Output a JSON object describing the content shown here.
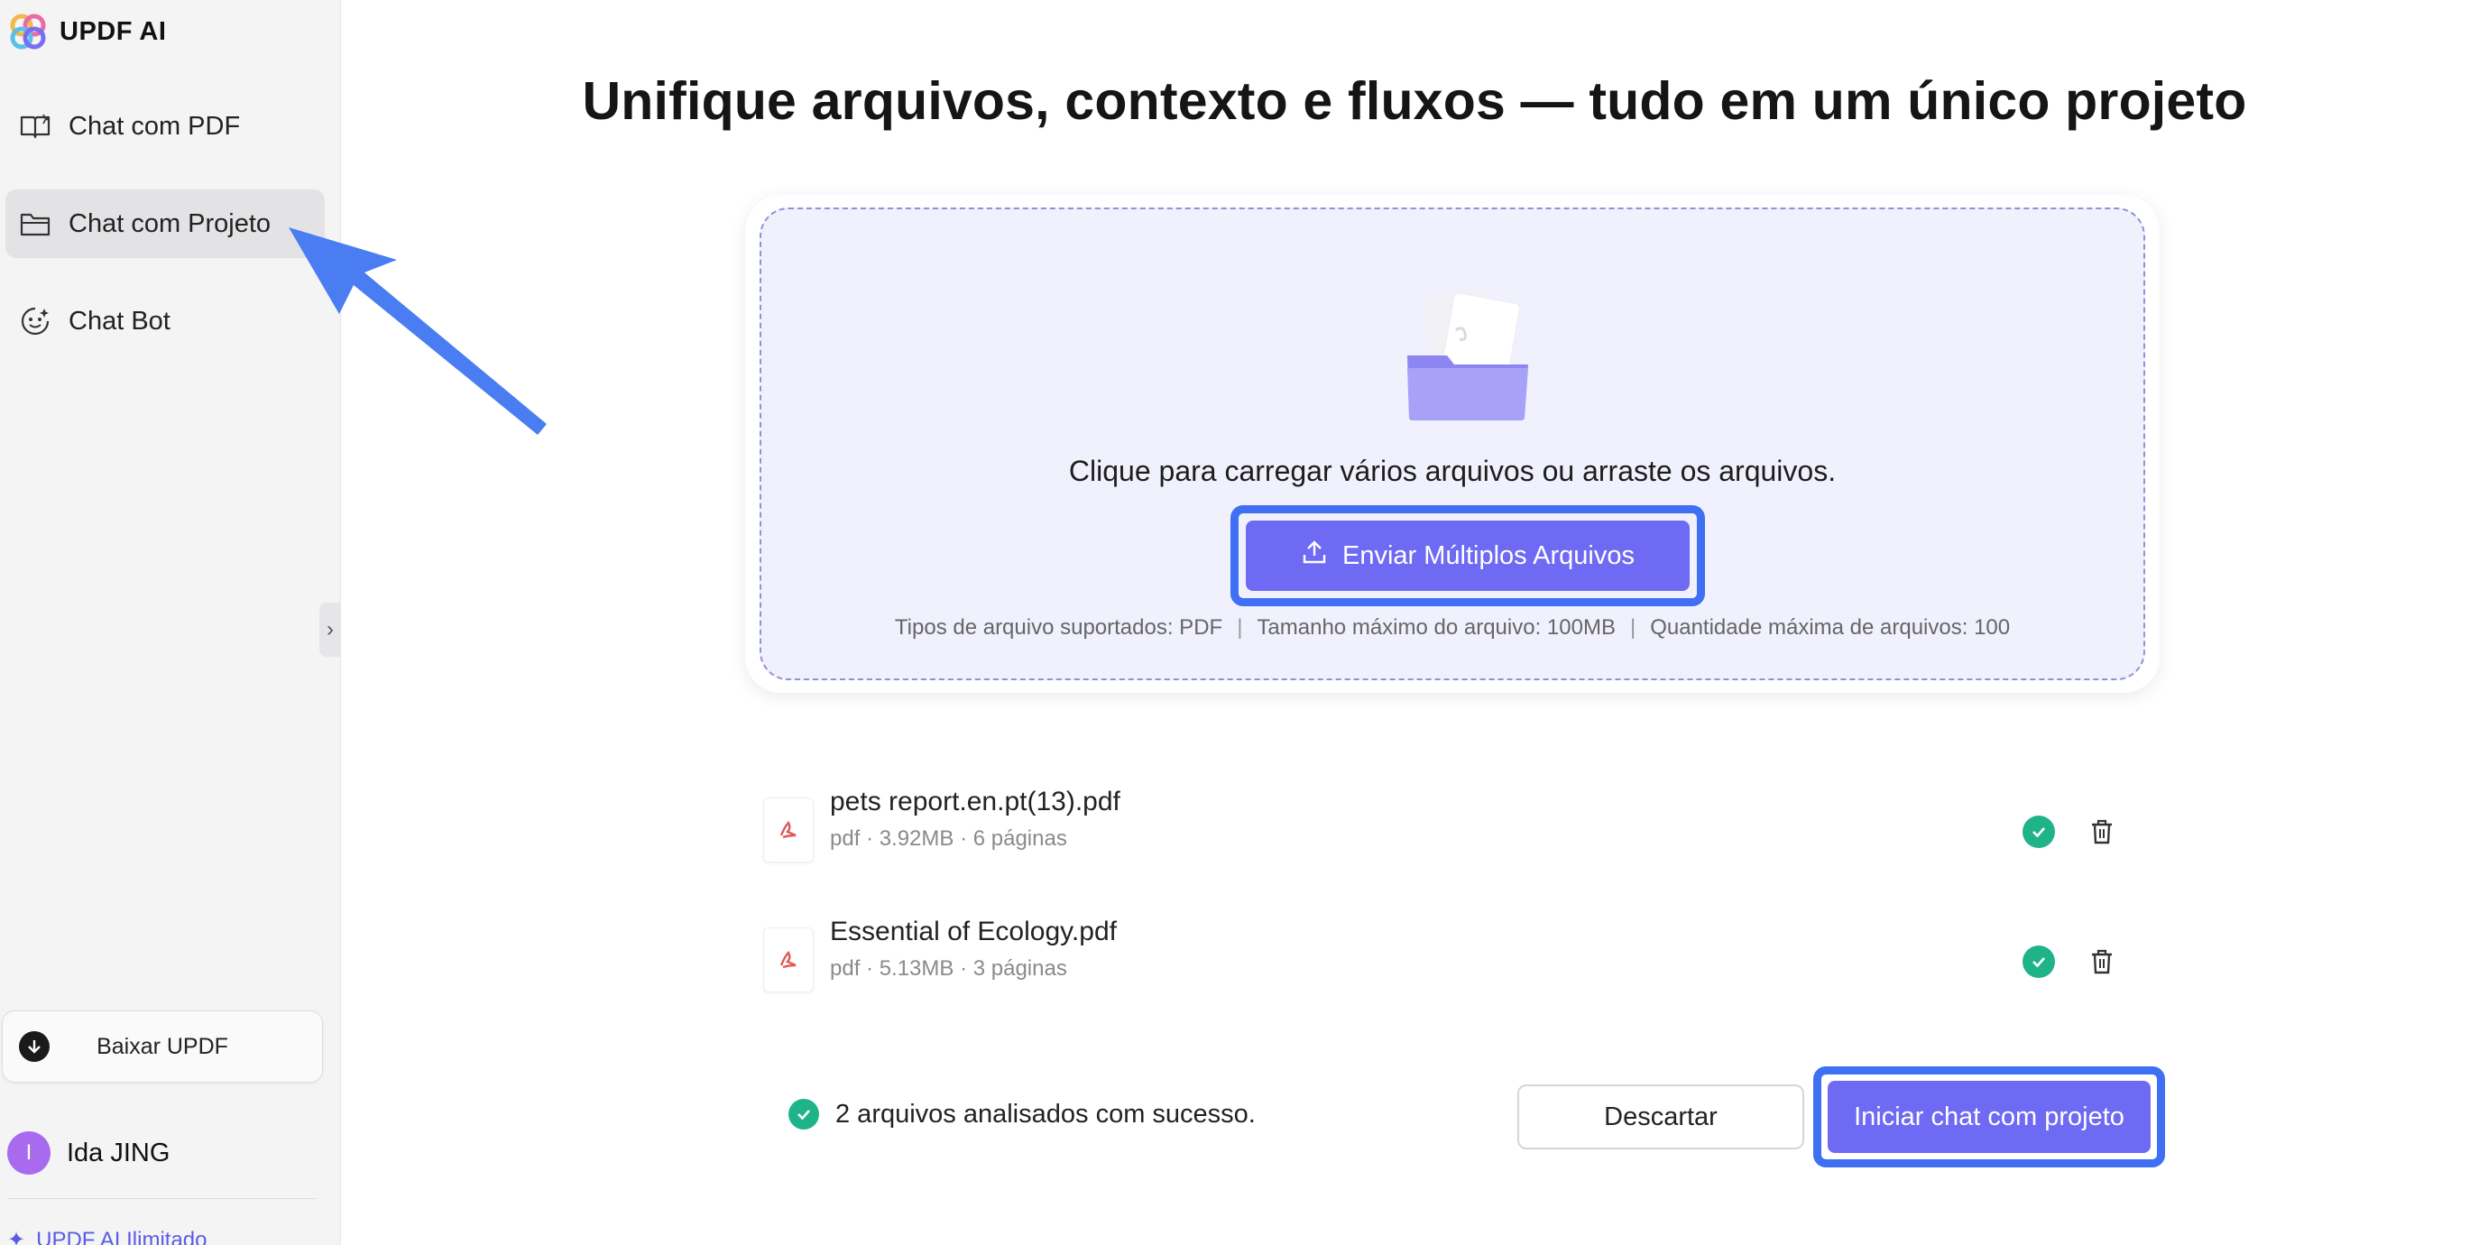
{
  "app": {
    "name": "UPDF AI"
  },
  "sidebar": {
    "items": [
      {
        "label": "Chat com PDF",
        "icon": "book-icon"
      },
      {
        "label": "Chat com Projeto",
        "icon": "folder-icon",
        "active": true
      },
      {
        "label": "Chat Bot",
        "icon": "bot-icon"
      }
    ],
    "download_label": "Baixar UPDF",
    "user": {
      "initial": "I",
      "name": "Ida JING"
    },
    "plan_label": "UPDF AI Ilimitado"
  },
  "main": {
    "headline": "Unifique arquivos, contexto e fluxos — tudo em um único projeto",
    "upload": {
      "instruction": "Clique para carregar vários arquivos ou arraste os arquivos.",
      "button_label": "Enviar Múltiplos Arquivos",
      "meta": [
        "Tipos de arquivo suportados: PDF",
        "Tamanho máximo do arquivo: 100MB",
        "Quantidade máxima de arquivos: 100"
      ]
    },
    "files": [
      {
        "name": "pets report.en.pt(13).pdf",
        "meta": "pdf · 3.92MB · 6 páginas"
      },
      {
        "name": "Essential of Ecology.pdf",
        "meta": "pdf · 5.13MB · 3 páginas"
      }
    ],
    "status_text": "2 arquivos analisados com sucesso.",
    "discard_label": "Descartar",
    "start_label": "Iniciar chat com projeto"
  },
  "colors": {
    "accent": "#6e6af3",
    "highlight": "#3f6ff2",
    "success": "#1fb38a",
    "sidebar_bg": "#f4f4f5"
  }
}
